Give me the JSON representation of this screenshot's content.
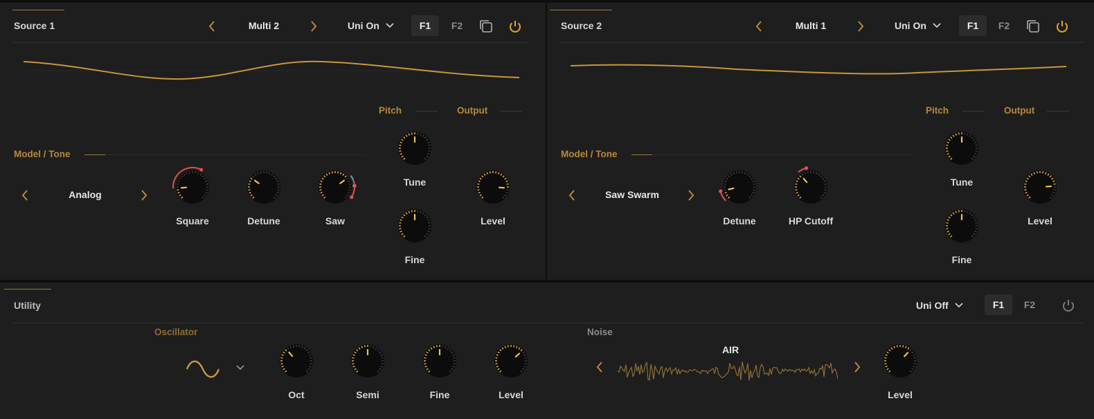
{
  "source1": {
    "title": "Source 1",
    "preset": "Multi 2",
    "unison": "Uni On",
    "filter1": "F1",
    "filter2": "F2",
    "section_model": "Model / Tone",
    "section_pitch": "Pitch",
    "section_output": "Output",
    "model": "Analog",
    "knobs": {
      "square": "Square",
      "detune": "Detune",
      "saw": "Saw",
      "tune": "Tune",
      "fine": "Fine",
      "level": "Level"
    }
  },
  "source2": {
    "title": "Source 2",
    "preset": "Multi 1",
    "unison": "Uni On",
    "filter1": "F1",
    "filter2": "F2",
    "section_model": "Model / Tone",
    "section_pitch": "Pitch",
    "section_output": "Output",
    "model": "Saw Swarm",
    "knobs": {
      "detune": "Detune",
      "hp_cutoff": "HP Cutoff",
      "tune": "Tune",
      "fine": "Fine",
      "level": "Level"
    }
  },
  "utility": {
    "title": "Utility",
    "unison": "Uni Off",
    "filter1": "F1",
    "filter2": "F2",
    "section_osc": "Oscillator",
    "section_noise": "Noise",
    "noise_type": "AIR",
    "knobs": {
      "oct": "Oct",
      "semi": "Semi",
      "fine": "Fine",
      "level": "Level",
      "noise_level": "Level"
    }
  },
  "colors": {
    "accent": "#b8893a",
    "bg": "#1e1e1e",
    "mod_red": "#e0504a",
    "mod_teal": "#4ab8b0"
  },
  "icons": [
    "chevron-left-icon",
    "chevron-right-icon",
    "chevron-down-icon",
    "copy-icon",
    "power-icon",
    "sine-wave-icon",
    "noise-waveform-icon"
  ]
}
